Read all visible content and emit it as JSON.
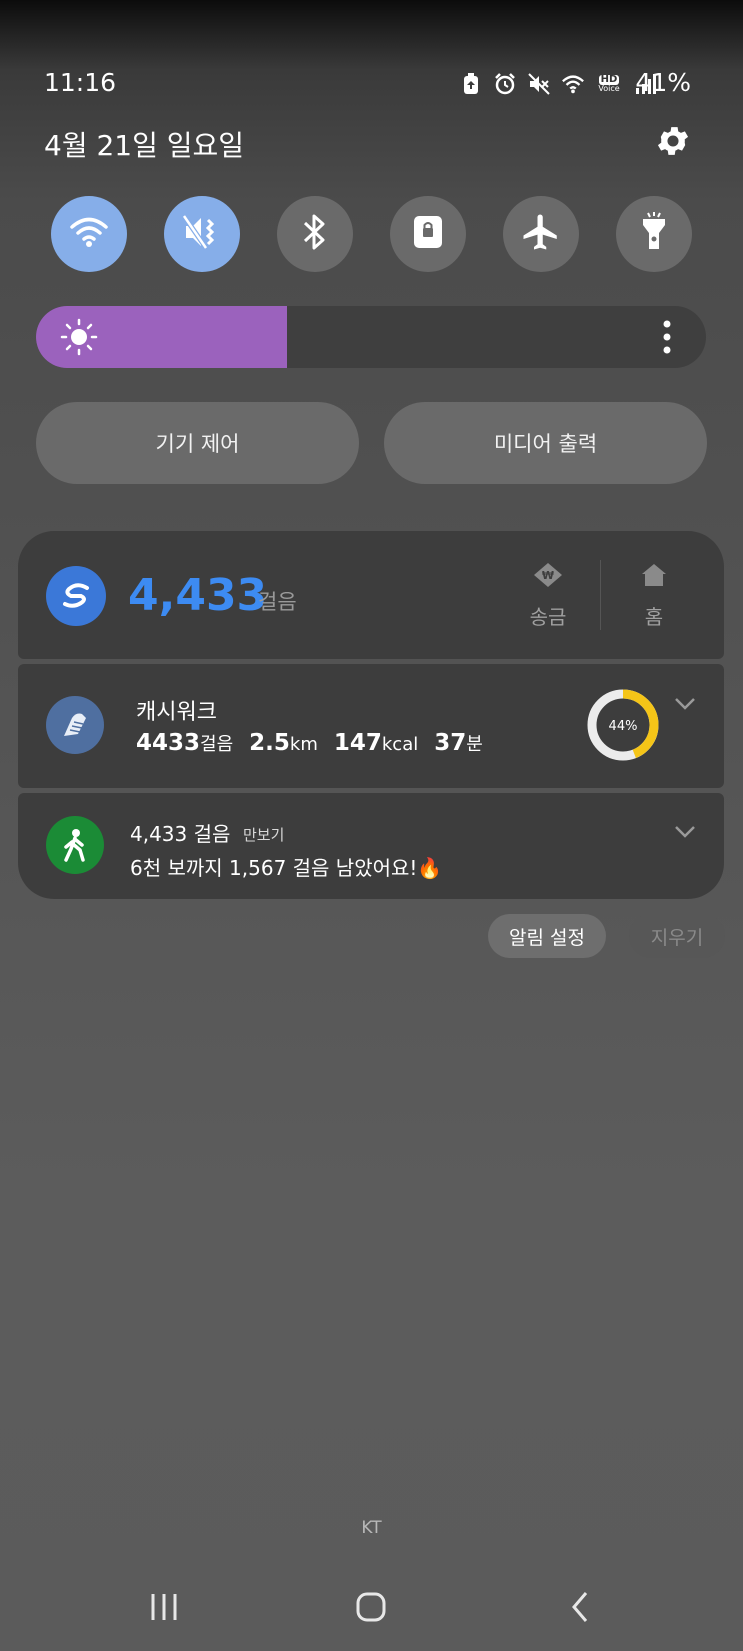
{
  "status_bar": {
    "time": "11:16",
    "battery_percent": "41%",
    "hd_label": "HD",
    "voice_label": "Voice",
    "icons": [
      "battery-saver-icon",
      "alarm-icon",
      "mute-icon",
      "wifi-icon",
      "hd-voice-icon",
      "signal-icon"
    ]
  },
  "header": {
    "date": "4월 21일 일요일",
    "settings_icon": "gear-icon"
  },
  "quick_toggles": [
    {
      "icon": "wifi-icon",
      "on": true
    },
    {
      "icon": "mute-icon",
      "on": true
    },
    {
      "icon": "bluetooth-icon",
      "on": false
    },
    {
      "icon": "rotation-lock-icon",
      "on": false
    },
    {
      "icon": "airplane-icon",
      "on": false
    },
    {
      "icon": "flashlight-icon",
      "on": false
    }
  ],
  "brightness": {
    "level": 0.375,
    "accent": "#9b62bd"
  },
  "controls": {
    "device_control": "기기 제어",
    "media_output": "미디어 출력"
  },
  "notifications": {
    "toss": {
      "steps": "4,433",
      "unit": "걸음",
      "action_send": "송금",
      "action_home": "홈"
    },
    "cashwalk": {
      "title": "캐시워크",
      "steps_value": "4433",
      "steps_unit": "걸음",
      "distance_value": "2.5",
      "distance_unit": "km",
      "kcal_value": "147",
      "kcal_unit": "kcal",
      "minutes_value": "37",
      "minutes_unit": "분",
      "progress_label": "44%",
      "progress": 0.44
    },
    "pedometer": {
      "title": "4,433 걸음",
      "app": "만보기",
      "message": "6천 보까지 1,567 걸음 남았어요!🔥"
    }
  },
  "footer_actions": {
    "notification_settings": "알림 설정",
    "clear": "지우기"
  },
  "carrier": "KT",
  "nav": {
    "recents_icon": "recents-icon",
    "home_icon": "home-icon",
    "back_icon": "back-icon"
  }
}
